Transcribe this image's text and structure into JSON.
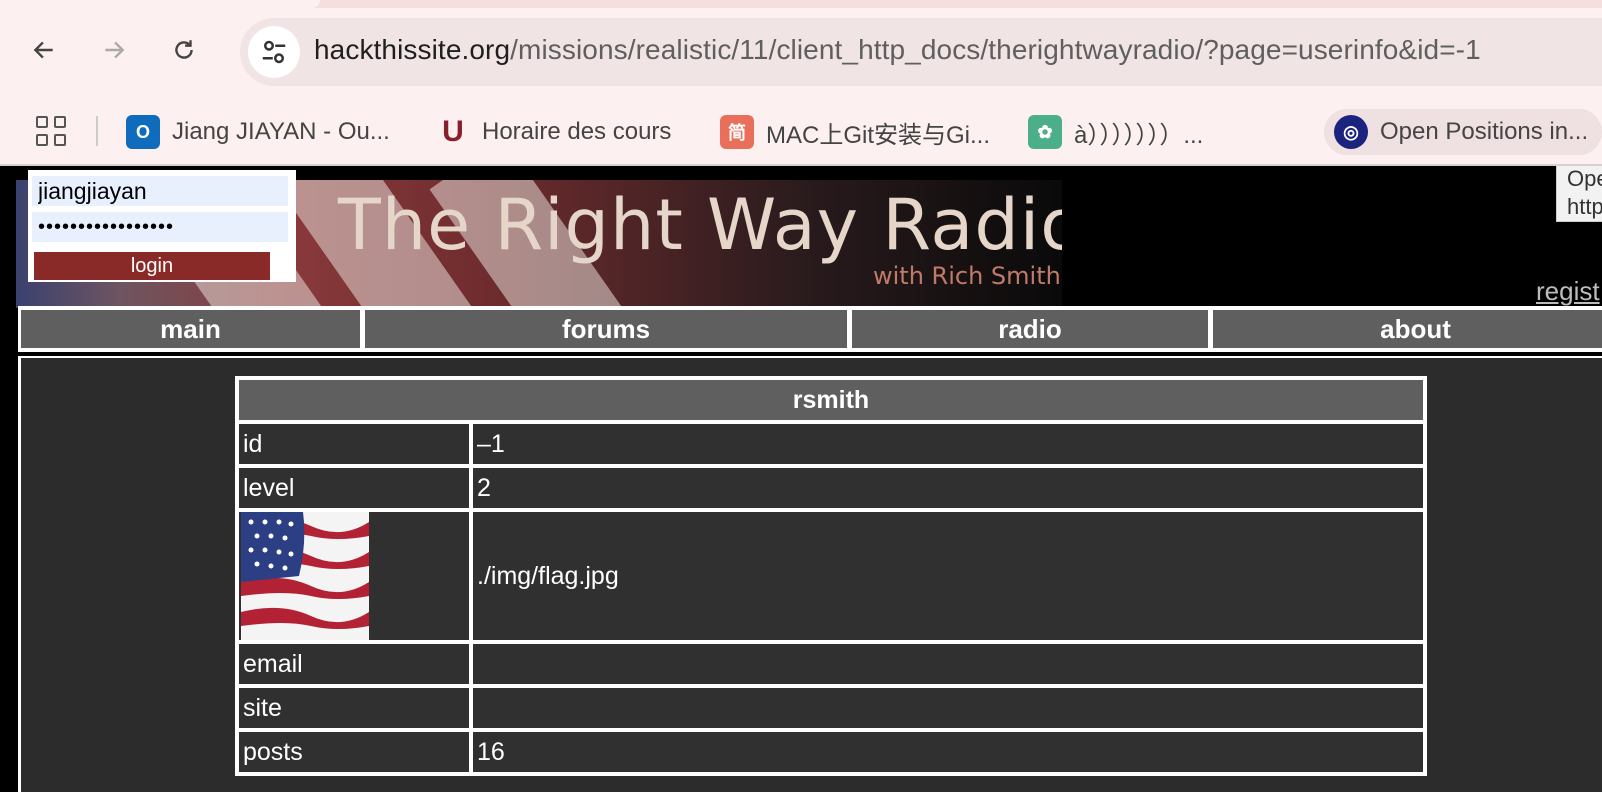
{
  "browser": {
    "url_host": "hackthissite.org",
    "url_path": "/missions/realistic/11/client_http_docs/therightwayradio/?page=userinfo&id=-1",
    "bookmarks": [
      {
        "label": "Jiang JIAYAN - Ou...",
        "icon": "outlook-icon",
        "color": "#0f6cbd"
      },
      {
        "label": "Horaire des cours",
        "icon": "university-logo-icon",
        "color": "#8b1e2d"
      },
      {
        "label": "MAC上Git安装与Gi...",
        "icon": "jianshu-icon",
        "color": "#ea6f5a"
      },
      {
        "label": "à）））））））...",
        "icon": "paw-icon",
        "color": "#4caf8a"
      },
      {
        "label": "Open Positions in...",
        "icon": "globe-icon",
        "color": "#1a237e"
      }
    ],
    "tooltip_line1": "Ope",
    "tooltip_line2": "http"
  },
  "page": {
    "banner_title": "The Right Way Radio",
    "banner_subtitle": "with Rich Smith",
    "login": {
      "username": "jiangjiayan",
      "password_mask": "•••••••••••••••••",
      "button": "login"
    },
    "register_link": "regist",
    "nav": [
      "main",
      "forums",
      "radio",
      "about"
    ],
    "user": {
      "name": "rsmith",
      "rows": [
        {
          "key": "id",
          "value": "–1"
        },
        {
          "key": "level",
          "value": "2"
        },
        {
          "key": "",
          "value": "./img/flag.jpg"
        },
        {
          "key": "email",
          "value": ""
        },
        {
          "key": "site",
          "value": ""
        },
        {
          "key": "posts",
          "value": "16"
        }
      ]
    }
  }
}
